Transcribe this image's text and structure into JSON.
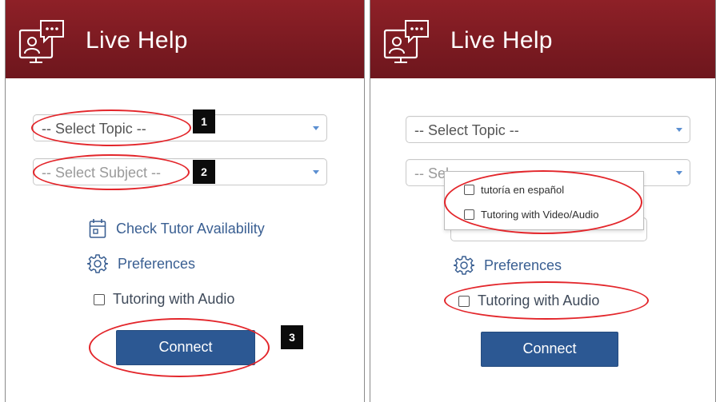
{
  "app": {
    "title": "Live Help"
  },
  "left": {
    "topic_select": {
      "value": "-- Select Topic --"
    },
    "subject_select": {
      "value": "-- Select Subject --"
    },
    "check_availability": {
      "label": "Check Tutor Availability"
    },
    "preferences": {
      "label": "Preferences"
    },
    "audio_option": {
      "label": "Tutoring with Audio"
    },
    "connect_button": {
      "label": "Connect"
    },
    "steps": [
      "1",
      "2",
      "3"
    ]
  },
  "right": {
    "topic_select": {
      "value": "-- Select Topic --"
    },
    "subject_select": {
      "value": "-- Sel"
    },
    "options_menu": {
      "items": [
        {
          "label": "tutoría en español"
        },
        {
          "label": "Tutoring with Video/Audio"
        }
      ]
    },
    "preferences": {
      "label": "Preferences"
    },
    "audio_option": {
      "label": "Tutoring with Audio"
    },
    "connect_button": {
      "label": "Connect"
    }
  },
  "colors": {
    "header": "#7a1a21",
    "button": "#2c5893",
    "link": "#3a5f92",
    "annotation": "#e3262b"
  },
  "icons": [
    "live-help-chat-icon",
    "calendar-icon",
    "gear-icon",
    "dropdown-caret-icon"
  ]
}
